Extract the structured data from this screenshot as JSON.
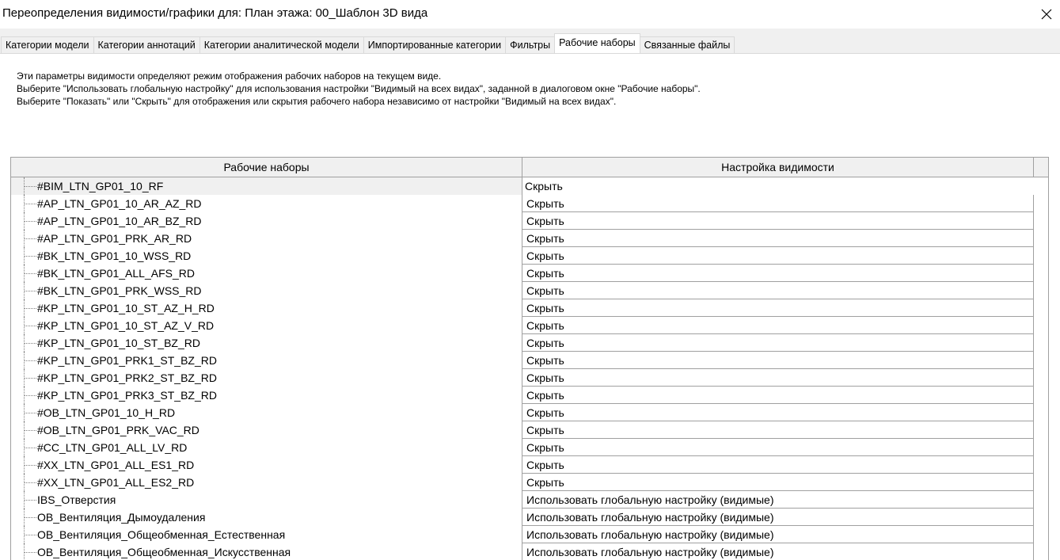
{
  "window": {
    "title": "Переопределения видимости/графики для: План этажа: 00_Шаблон 3D вида"
  },
  "tabs": [
    {
      "label": "Категории модели",
      "active": false
    },
    {
      "label": "Категории аннотаций",
      "active": false
    },
    {
      "label": "Категории аналитической модели",
      "active": false
    },
    {
      "label": "Импортированные категории",
      "active": false
    },
    {
      "label": "Фильтры",
      "active": false
    },
    {
      "label": "Рабочие наборы",
      "active": true
    },
    {
      "label": "Связанные файлы",
      "active": false
    }
  ],
  "info": {
    "line1": "Эти параметры видимости определяют режим отображения рабочих наборов на текущем виде.",
    "line2": "Выберите \"Использовать глобальную настройку\" для использования настройки \"Видимый на всех видах\", заданной в диалоговом окне \"Рабочие наборы\".",
    "line3": "Выберите \"Показать\" или \"Скрыть\" для отображения или скрытия рабочего набора независимо от настройки \"Видимый на всех видах\"."
  },
  "table": {
    "columns": [
      "Рабочие наборы",
      "Настройка видимости"
    ],
    "rows": [
      {
        "name": "#BIM_LTN_GP01_10_RF",
        "visibility": "Скрыть",
        "selected": true
      },
      {
        "name": "#AP_LTN_GP01_10_AR_AZ_RD",
        "visibility": "Скрыть"
      },
      {
        "name": "#AP_LTN_GP01_10_AR_BZ_RD",
        "visibility": "Скрыть"
      },
      {
        "name": "#AP_LTN_GP01_PRK_AR_RD",
        "visibility": "Скрыть"
      },
      {
        "name": "#BK_LTN_GP01_10_WSS_RD",
        "visibility": "Скрыть"
      },
      {
        "name": "#BK_LTN_GP01_ALL_AFS_RD",
        "visibility": "Скрыть"
      },
      {
        "name": "#BK_LTN_GP01_PRK_WSS_RD",
        "visibility": "Скрыть"
      },
      {
        "name": "#KP_LTN_GP01_10_ST_AZ_H_RD",
        "visibility": "Скрыть"
      },
      {
        "name": "#KP_LTN_GP01_10_ST_AZ_V_RD",
        "visibility": "Скрыть"
      },
      {
        "name": "#KP_LTN_GP01_10_ST_BZ_RD",
        "visibility": "Скрыть"
      },
      {
        "name": "#KP_LTN_GP01_PRK1_ST_BZ_RD",
        "visibility": "Скрыть"
      },
      {
        "name": "#KP_LTN_GP01_PRK2_ST_BZ_RD",
        "visibility": "Скрыть"
      },
      {
        "name": "#KP_LTN_GP01_PRK3_ST_BZ_RD",
        "visibility": "Скрыть"
      },
      {
        "name": "#OB_LTN_GP01_10_H_RD",
        "visibility": "Скрыть"
      },
      {
        "name": "#OB_LTN_GP01_PRK_VAC_RD",
        "visibility": "Скрыть"
      },
      {
        "name": "#CC_LTN_GP01_ALL_LV_RD",
        "visibility": "Скрыть"
      },
      {
        "name": "#XX_LTN_GP01_ALL_ES1_RD",
        "visibility": "Скрыть"
      },
      {
        "name": "#XX_LTN_GP01_ALL_ES2_RD",
        "visibility": "Скрыть"
      },
      {
        "name": "IBS_Отверстия",
        "visibility": "Использовать глобальную настройку (видимые)"
      },
      {
        "name": "OB_Вентиляция_Дымоудаления",
        "visibility": "Использовать глобальную настройку (видимые)"
      },
      {
        "name": "OB_Вентиляция_Общеобменная_Естественная",
        "visibility": "Использовать глобальную настройку (видимые)"
      },
      {
        "name": "OB_Вентиляция_Общеобменная_Искусственная",
        "visibility": "Использовать глобальную настройку (видимые)"
      }
    ]
  },
  "icons": {
    "close": "close-icon"
  }
}
